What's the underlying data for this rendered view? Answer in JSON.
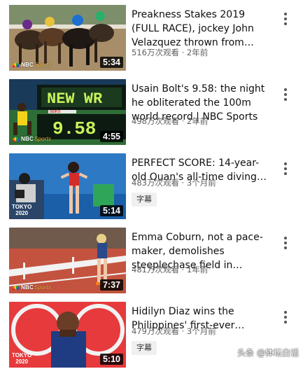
{
  "videos": [
    {
      "title": "Preakness Stakes 2019 (FULL RACE), jockey John Velazquez thrown from hors…",
      "views": "516万次观看",
      "age": "2年前",
      "duration": "5:34",
      "channel_logo": "NBC Sports",
      "badge": ""
    },
    {
      "title": "Usain Bolt's 9.58: the night he obliterated the 100m world record | NBC Sports",
      "views": "498万次观看",
      "age": "2年前",
      "duration": "4:55",
      "channel_logo": "NBC Sports",
      "badge": ""
    },
    {
      "title": "PERFECT SCORE: 14-year-old Quan's all-time diving final…",
      "views": "483万次观看",
      "age": "3个月前",
      "duration": "5:14",
      "channel_logo": "TOKYO",
      "badge": "字幕"
    },
    {
      "title": "Emma Coburn, not a pace-maker, demolishes steeplechase field in…",
      "views": "481万次观看",
      "age": "1年前",
      "duration": "7:37",
      "channel_logo": "NBC Sports",
      "badge": ""
    },
    {
      "title": "Hidilyn Diaz wins the Philippines' first-ever Olymp…",
      "views": "479万次观看",
      "age": "3个月前",
      "duration": "5:10",
      "channel_logo": "TOKYO",
      "badge": "字幕"
    }
  ],
  "meta_separator": "·",
  "watermark": "头条 @体坛白话",
  "icons": {
    "more": "more-vert-icon"
  },
  "colors": {
    "title": "#0f0f0f",
    "meta": "#606060",
    "badge_bg": "#f0f0f0",
    "duration_bg": "#000000"
  }
}
